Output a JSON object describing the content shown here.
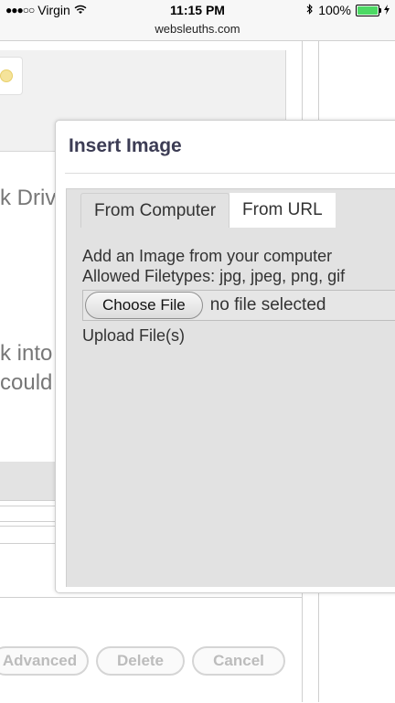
{
  "status_bar": {
    "carrier": "Virgin",
    "time": "11:15 PM",
    "battery": "100%"
  },
  "url": "websleuths.com",
  "background": {
    "text_line1": "k Driv",
    "text_line2": "k into",
    "text_line3": "could",
    "buttons": {
      "advanced": "Advanced",
      "delete": "Delete",
      "cancel": "Cancel"
    }
  },
  "dialog": {
    "title": "Insert Image",
    "tabs": [
      {
        "label": "From Computer",
        "active": true
      },
      {
        "label": "From URL",
        "active": false
      }
    ],
    "description": "Add an Image from your computer",
    "filetypes": "Allowed Filetypes: jpg, jpeg, png, gif",
    "choose_file_label": "Choose File",
    "no_file_text": "no file selected",
    "upload_label": "Upload File(s)"
  }
}
